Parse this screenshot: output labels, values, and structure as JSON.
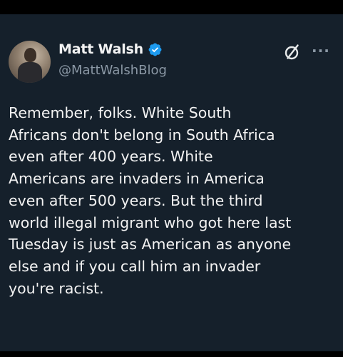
{
  "author": {
    "display_name": "Matt Walsh",
    "handle": "@MattWalshBlog",
    "verified": true,
    "verified_color": "#1d9bf0",
    "avatar_icon": "profile-photo"
  },
  "actions": {
    "grok_icon": "grok-icon",
    "more_label": "···"
  },
  "tweet": {
    "lines": [
      "Remember, folks. White South",
      "Africans don't belong in South Africa",
      "even after 400 years. White",
      "Americans are invaders in America",
      "even after 500 years. But the third",
      "world illegal migrant who got here last",
      "Tuesday is just as American as anyone",
      "else and if you call him an invader",
      "you're racist."
    ]
  },
  "colors": {
    "background": "#15202b",
    "text": "#f2f2f2",
    "secondary_text": "#8b98a5"
  }
}
